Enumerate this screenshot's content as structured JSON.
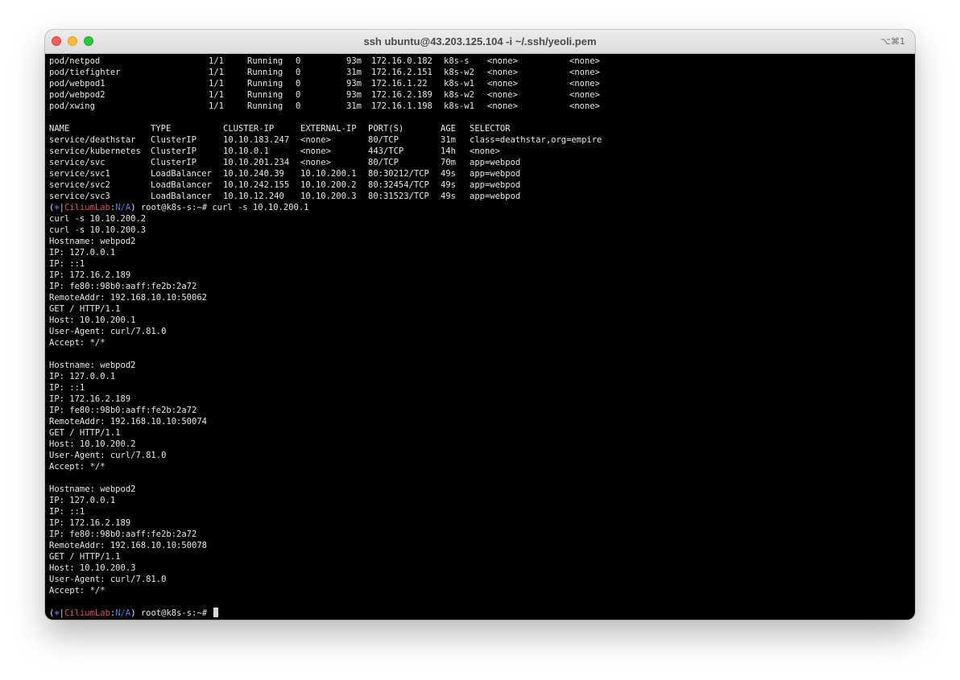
{
  "window": {
    "title": "ssh ubuntu@43.203.125.104 -i ~/.ssh/yeoli.pem",
    "shortcut": "⌥⌘1"
  },
  "pods": [
    {
      "name": "pod/netpod",
      "ready": "1/1",
      "status": "Running",
      "restarts": "0",
      "age": "93m",
      "ip": "172.16.0.182",
      "node": "k8s-s",
      "nominated": "<none>",
      "gates": "<none>"
    },
    {
      "name": "pod/tiefighter",
      "ready": "1/1",
      "status": "Running",
      "restarts": "0",
      "age": "31m",
      "ip": "172.16.2.151",
      "node": "k8s-w2",
      "nominated": "<none>",
      "gates": "<none>"
    },
    {
      "name": "pod/webpod1",
      "ready": "1/1",
      "status": "Running",
      "restarts": "0",
      "age": "93m",
      "ip": "172.16.1.22",
      "node": "k8s-w1",
      "nominated": "<none>",
      "gates": "<none>"
    },
    {
      "name": "pod/webpod2",
      "ready": "1/1",
      "status": "Running",
      "restarts": "0",
      "age": "93m",
      "ip": "172.16.2.189",
      "node": "k8s-w2",
      "nominated": "<none>",
      "gates": "<none>"
    },
    {
      "name": "pod/xwing",
      "ready": "1/1",
      "status": "Running",
      "restarts": "0",
      "age": "31m",
      "ip": "172.16.1.198",
      "node": "k8s-w1",
      "nominated": "<none>",
      "gates": "<none>"
    }
  ],
  "service_headers": [
    "NAME",
    "TYPE",
    "CLUSTER-IP",
    "EXTERNAL-IP",
    "PORT(S)",
    "AGE",
    "SELECTOR"
  ],
  "services": [
    [
      "service/deathstar",
      "ClusterIP",
      "10.10.183.247",
      "<none>",
      "80/TCP",
      "31m",
      "class=deathstar,org=empire"
    ],
    [
      "service/kubernetes",
      "ClusterIP",
      "10.10.0.1",
      "<none>",
      "443/TCP",
      "14h",
      "<none>"
    ],
    [
      "service/svc",
      "ClusterIP",
      "10.10.201.234",
      "<none>",
      "80/TCP",
      "70m",
      "app=webpod"
    ],
    [
      "service/svc1",
      "LoadBalancer",
      "10.10.240.39",
      "10.10.200.1",
      "80:30212/TCP",
      "49s",
      "app=webpod"
    ],
    [
      "service/svc2",
      "LoadBalancer",
      "10.10.242.155",
      "10.10.200.2",
      "80:32454/TCP",
      "49s",
      "app=webpod"
    ],
    [
      "service/svc3",
      "LoadBalancer",
      "10.10.12.240",
      "10.10.200.3",
      "80:31523/TCP",
      "49s",
      "app=webpod"
    ]
  ],
  "prompt": {
    "open": "(",
    "bullet": "⎈",
    "bar": "|",
    "context": "CiliumLab",
    "colon": ":",
    "namespace": "N/A",
    "close": ")",
    "user_host": " root@k8s-s:~# "
  },
  "command": "curl -s 10.10.200.1",
  "pasted_lines": [
    "curl -s 10.10.200.2",
    "curl -s 10.10.200.3"
  ],
  "responses": [
    [
      "Hostname: webpod2",
      "IP: 127.0.0.1",
      "IP: ::1",
      "IP: 172.16.2.189",
      "IP: fe80::98b0:aaff:fe2b:2a72",
      "RemoteAddr: 192.168.10.10:50062",
      "GET / HTTP/1.1",
      "Host: 10.10.200.1",
      "User-Agent: curl/7.81.0",
      "Accept: */*"
    ],
    [
      "Hostname: webpod2",
      "IP: 127.0.0.1",
      "IP: ::1",
      "IP: 172.16.2.189",
      "IP: fe80::98b0:aaff:fe2b:2a72",
      "RemoteAddr: 192.168.10.10:50074",
      "GET / HTTP/1.1",
      "Host: 10.10.200.2",
      "User-Agent: curl/7.81.0",
      "Accept: */*"
    ],
    [
      "Hostname: webpod2",
      "IP: 127.0.0.1",
      "IP: ::1",
      "IP: 172.16.2.189",
      "IP: fe80::98b0:aaff:fe2b:2a72",
      "RemoteAddr: 192.168.10.10:50078",
      "GET / HTTP/1.1",
      "Host: 10.10.200.3",
      "User-Agent: curl/7.81.0",
      "Accept: */*"
    ]
  ]
}
